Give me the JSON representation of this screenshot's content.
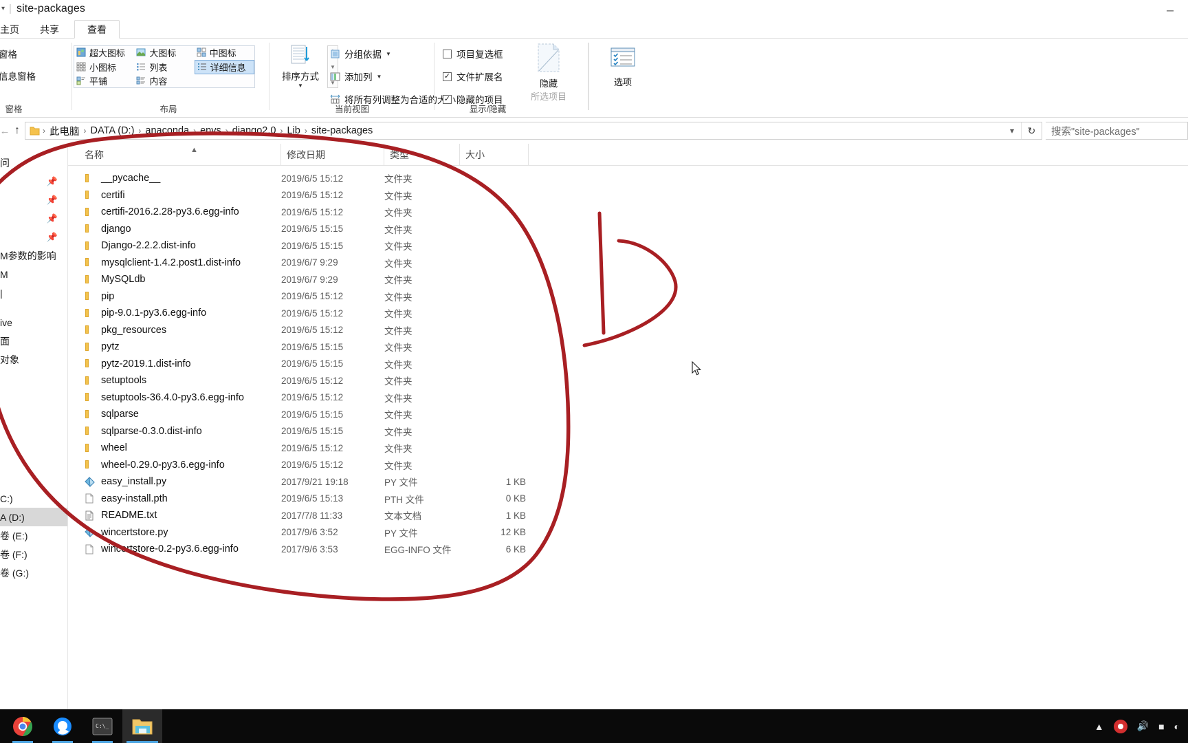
{
  "window": {
    "title": "site-packages",
    "qat_icons": [
      "folder-small-icon",
      "dropdown-icon"
    ],
    "minimize_label": "─",
    "maximize_label": "☐",
    "close_label": "✕"
  },
  "ribbon": {
    "tabs": [
      {
        "label": "主页",
        "active": false
      },
      {
        "label": "共享",
        "active": false
      },
      {
        "label": "查看",
        "active": true
      }
    ],
    "groups": [
      {
        "label": "窗格"
      },
      {
        "label": "布局"
      },
      {
        "label": "当前视图"
      },
      {
        "label": "显示/隐藏"
      }
    ],
    "panes": [
      {
        "label": "预览窗格",
        "icon": "preview-pane-icon"
      },
      {
        "label": "详细信息窗格",
        "icon": "details-pane-icon"
      }
    ],
    "layout_gallery": [
      {
        "label": "超大图标",
        "icon": "extra-large-icons-icon",
        "selected": false
      },
      {
        "label": "大图标",
        "icon": "large-icons-icon",
        "selected": false
      },
      {
        "label": "中图标",
        "icon": "medium-icons-icon",
        "selected": false
      },
      {
        "label": "小图标",
        "icon": "small-icons-icon",
        "selected": false
      },
      {
        "label": "列表",
        "icon": "list-view-icon",
        "selected": false
      },
      {
        "label": "详细信息",
        "icon": "details-view-icon",
        "selected": true
      },
      {
        "label": "平铺",
        "icon": "tiles-view-icon",
        "selected": false
      },
      {
        "label": "内容",
        "icon": "content-view-icon",
        "selected": false
      }
    ],
    "sort_by": {
      "label": "排序方式",
      "icon": "sort-icon"
    },
    "current_view": [
      {
        "label": "分组依据",
        "icon": "group-by-icon",
        "dropdown": true
      },
      {
        "label": "添加列",
        "icon": "add-columns-icon",
        "dropdown": true
      },
      {
        "label": "将所有列调整为合适的大小",
        "icon": "size-columns-icon",
        "dropdown": false
      }
    ],
    "show_hide": [
      {
        "label": "项目复选框",
        "checked": false
      },
      {
        "label": "文件扩展名",
        "checked": true
      },
      {
        "label": "隐藏的项目",
        "checked": true
      }
    ],
    "hide_selected": {
      "line1": "隐藏",
      "line2": "所选项目",
      "icon": "hide-selected-icon"
    },
    "options": {
      "label": "选项",
      "icon": "options-icon"
    }
  },
  "address": {
    "back_icon": "back-arrow-icon",
    "forward_icon": "forward-arrow-icon",
    "up_icon": "up-arrow-icon",
    "folder_icon": "folder-icon",
    "crumbs": [
      "此电脑",
      "DATA (D:)",
      "anaconda",
      "envs",
      "django2.0",
      "Lib",
      "site-packages"
    ],
    "separator": "›",
    "dropdown_icon": "chevron-down-icon",
    "refresh_icon": "refresh-icon",
    "search_placeholder": "搜索\"site-packages\""
  },
  "sidebar": {
    "items": [
      {
        "label": "问",
        "pin": false,
        "selected": false,
        "type": "header"
      },
      {
        "label": "",
        "pin": true,
        "selected": false
      },
      {
        "label": "",
        "pin": true,
        "selected": false
      },
      {
        "label": "",
        "pin": true,
        "selected": false
      },
      {
        "label": "",
        "pin": true,
        "selected": false
      },
      {
        "label": "M参数的影响",
        "pin": false,
        "selected": false
      },
      {
        "label": "M",
        "pin": false,
        "selected": false
      },
      {
        "label": "|",
        "pin": false,
        "selected": false
      },
      {
        "label": "ive",
        "pin": false,
        "selected": false
      },
      {
        "label": "面",
        "pin": false,
        "selected": false
      },
      {
        "label": "对象",
        "pin": false,
        "selected": false
      },
      {
        "label": "C:)",
        "pin": false,
        "selected": false
      },
      {
        "label": "A (D:)",
        "pin": false,
        "selected": true
      },
      {
        "label": "卷 (E:)",
        "pin": false,
        "selected": false
      },
      {
        "label": "卷 (F:)",
        "pin": false,
        "selected": false
      },
      {
        "label": "卷 (G:)",
        "pin": false,
        "selected": false
      }
    ]
  },
  "columns": [
    {
      "label": "名称",
      "sorted": true,
      "sort_dir": "asc"
    },
    {
      "label": "修改日期",
      "sorted": false
    },
    {
      "label": "类型",
      "sorted": false
    },
    {
      "label": "大小",
      "sorted": false
    }
  ],
  "files": [
    {
      "name": "__pycache__",
      "date": "2019/6/5 15:12",
      "type": "文件夹",
      "size": "",
      "icon": "folder-icon"
    },
    {
      "name": "certifi",
      "date": "2019/6/5 15:12",
      "type": "文件夹",
      "size": "",
      "icon": "folder-icon"
    },
    {
      "name": "certifi-2016.2.28-py3.6.egg-info",
      "date": "2019/6/5 15:12",
      "type": "文件夹",
      "size": "",
      "icon": "folder-icon"
    },
    {
      "name": "django",
      "date": "2019/6/5 15:15",
      "type": "文件夹",
      "size": "",
      "icon": "folder-icon"
    },
    {
      "name": "Django-2.2.2.dist-info",
      "date": "2019/6/5 15:15",
      "type": "文件夹",
      "size": "",
      "icon": "folder-icon"
    },
    {
      "name": "mysqlclient-1.4.2.post1.dist-info",
      "date": "2019/6/7 9:29",
      "type": "文件夹",
      "size": "",
      "icon": "folder-icon"
    },
    {
      "name": "MySQLdb",
      "date": "2019/6/7 9:29",
      "type": "文件夹",
      "size": "",
      "icon": "folder-icon"
    },
    {
      "name": "pip",
      "date": "2019/6/5 15:12",
      "type": "文件夹",
      "size": "",
      "icon": "folder-icon"
    },
    {
      "name": "pip-9.0.1-py3.6.egg-info",
      "date": "2019/6/5 15:12",
      "type": "文件夹",
      "size": "",
      "icon": "folder-icon"
    },
    {
      "name": "pkg_resources",
      "date": "2019/6/5 15:12",
      "type": "文件夹",
      "size": "",
      "icon": "folder-icon"
    },
    {
      "name": "pytz",
      "date": "2019/6/5 15:15",
      "type": "文件夹",
      "size": "",
      "icon": "folder-icon"
    },
    {
      "name": "pytz-2019.1.dist-info",
      "date": "2019/6/5 15:15",
      "type": "文件夹",
      "size": "",
      "icon": "folder-icon"
    },
    {
      "name": "setuptools",
      "date": "2019/6/5 15:12",
      "type": "文件夹",
      "size": "",
      "icon": "folder-icon"
    },
    {
      "name": "setuptools-36.4.0-py3.6.egg-info",
      "date": "2019/6/5 15:12",
      "type": "文件夹",
      "size": "",
      "icon": "folder-icon"
    },
    {
      "name": "sqlparse",
      "date": "2019/6/5 15:15",
      "type": "文件夹",
      "size": "",
      "icon": "folder-icon"
    },
    {
      "name": "sqlparse-0.3.0.dist-info",
      "date": "2019/6/5 15:15",
      "type": "文件夹",
      "size": "",
      "icon": "folder-icon"
    },
    {
      "name": "wheel",
      "date": "2019/6/5 15:12",
      "type": "文件夹",
      "size": "",
      "icon": "folder-icon"
    },
    {
      "name": "wheel-0.29.0-py3.6.egg-info",
      "date": "2019/6/5 15:12",
      "type": "文件夹",
      "size": "",
      "icon": "folder-icon"
    },
    {
      "name": "easy_install.py",
      "date": "2017/9/21 19:18",
      "type": "PY 文件",
      "size": "1 KB",
      "icon": "python-file-icon"
    },
    {
      "name": "easy-install.pth",
      "date": "2019/6/5 15:13",
      "type": "PTH 文件",
      "size": "0 KB",
      "icon": "generic-file-icon"
    },
    {
      "name": "README.txt",
      "date": "2017/7/8 11:33",
      "type": "文本文档",
      "size": "1 KB",
      "icon": "text-file-icon"
    },
    {
      "name": "wincertstore.py",
      "date": "2017/9/6 3:52",
      "type": "PY 文件",
      "size": "12 KB",
      "icon": "python-file-icon"
    },
    {
      "name": "wincertstore-0.2-py3.6.egg-info",
      "date": "2017/9/6 3:53",
      "type": "EGG-INFO 文件",
      "size": "6 KB",
      "icon": "generic-file-icon"
    }
  ],
  "annotation": {
    "color": "#a81f23",
    "shapes": [
      "circle-lasso",
      "letter-d-mark"
    ]
  },
  "taskbar": {
    "items": [
      {
        "name": "chrome",
        "state": "open"
      },
      {
        "name": "qq-browser",
        "state": "open"
      },
      {
        "name": "terminal",
        "state": "open"
      },
      {
        "name": "file-explorer",
        "state": "active"
      }
    ],
    "tray": [
      "chevron-up-icon",
      "record-icon",
      "volume-icon",
      "battery-icon",
      "network-icon"
    ]
  }
}
